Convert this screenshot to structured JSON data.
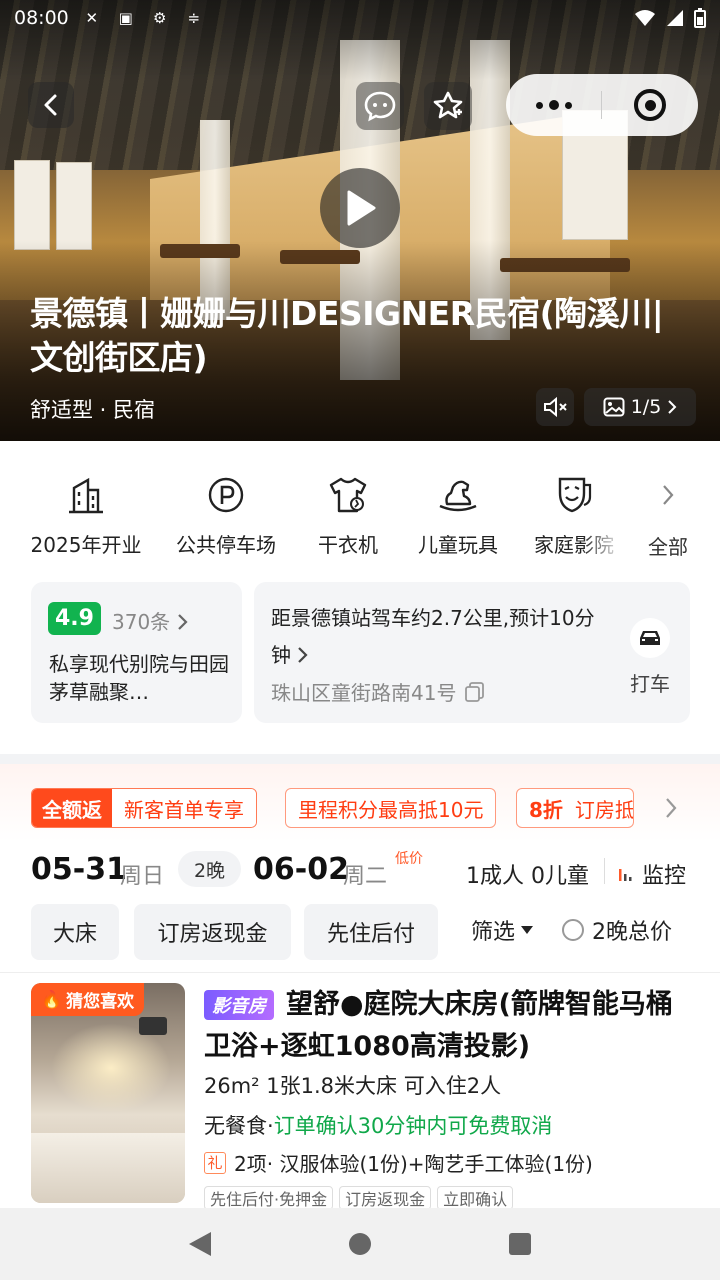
{
  "status_bar": {
    "time": "08:00"
  },
  "hero": {
    "title": "景德镇丨姗姗与川DESIGNER民宿(陶溪川|文创街区店)",
    "type": "舒适型 · 民宿",
    "album_counter": "1/5"
  },
  "facilities": [
    {
      "label": "2025年开业",
      "icon": "building-icon"
    },
    {
      "label": "公共停车场",
      "icon": "parking-icon"
    },
    {
      "label": "干衣机",
      "icon": "dryer-icon"
    },
    {
      "label": "儿童玩具",
      "icon": "toy-horse-icon"
    },
    {
      "label": "家庭影院",
      "icon": "theater-mask-icon"
    }
  ],
  "facilities_all": "全部",
  "rating": {
    "score": "4.9",
    "count": "370条",
    "summary": "私享现代别院与田园茅草融聚…"
  },
  "location": {
    "distance": "距景德镇站驾车约2.7公里,预计10分钟",
    "address": "珠山区童街路南41号",
    "taxi_label": "打车"
  },
  "promos": {
    "first_tag": "全额返",
    "first_text": "新客首单专享",
    "second": "里程积分最高抵10元",
    "third_discount": "8折",
    "third_text": "订房抵"
  },
  "dates": {
    "checkin": "05-31",
    "checkin_week": "周日",
    "nights": "2晚",
    "checkout": "06-02",
    "checkout_week": "周二",
    "low_price": "低价",
    "guests": "1成人  0儿童",
    "monitor": "监控"
  },
  "filters": {
    "chips": [
      "大床",
      "订房返现金",
      "先住后付"
    ],
    "filter_label": "筛选",
    "total_price_label": "2晚总价"
  },
  "room": {
    "guess_tag": "猜您喜欢",
    "badge": "影音房",
    "name": "望舒●庭院大床房(箭牌智能马桶卫浴+逐虹1080高清投影)",
    "spec": "26m²   1张1.8米大床   可入住2人",
    "meal": "无餐食·",
    "cancel": "订单确认30分钟内可免费取消",
    "gift_tag": "礼",
    "gift": "2项· 汉服体验(1份)+陶艺手工体验(1份)",
    "tags": [
      "先住后付·免押金",
      "订房返现金",
      "立即确认"
    ]
  }
}
